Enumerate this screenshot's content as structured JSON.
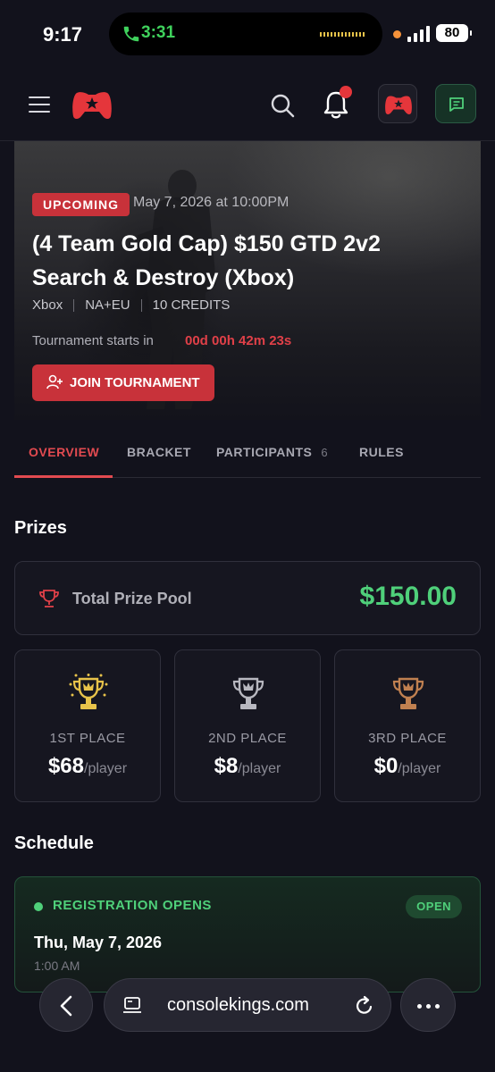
{
  "status_bar": {
    "time": "9:17",
    "call_timer": "3:31",
    "battery": "80"
  },
  "header": {
    "icons": [
      "menu-icon",
      "logo-icon",
      "search-icon",
      "bell-icon",
      "avatar-icon",
      "chat-icon"
    ],
    "notification_dot_color": "#e5363b"
  },
  "hero": {
    "badge": "UPCOMING",
    "date": "May 7, 2026 at 10:00PM",
    "title": "(4 Team Gold Cap) $150 GTD 2v2 Search & Destroy (Xbox)",
    "platform": "Xbox",
    "region": "NA+EU",
    "credits": "10 CREDITS",
    "starts_label": "Tournament starts in",
    "countdown": "00d 00h 42m 23s",
    "join_label": "JOIN TOURNAMENT"
  },
  "tabs": [
    {
      "label": "OVERVIEW",
      "active": true
    },
    {
      "label": "BRACKET",
      "active": false
    },
    {
      "label": "PARTICIPANTS",
      "count": "6",
      "active": false
    },
    {
      "label": "RULES",
      "active": false
    }
  ],
  "prizes": {
    "title": "Prizes",
    "pool_label": "Total Prize Pool",
    "pool_amount": "$150.00",
    "places": [
      {
        "label": "1ST PLACE",
        "amount": "$68",
        "unit": "/player",
        "color": "#e8c34a"
      },
      {
        "label": "2ND PLACE",
        "amount": "$8",
        "unit": "/player",
        "color": "#b8b8c0"
      },
      {
        "label": "3RD PLACE",
        "amount": "$0",
        "unit": "/player",
        "color": "#c08050"
      }
    ]
  },
  "schedule": {
    "title": "Schedule",
    "item_label": "REGISTRATION OPENS",
    "status": "OPEN",
    "date": "Thu, May 7, 2026",
    "time": "1:00 AM"
  },
  "browser": {
    "url": "consolekings.com"
  },
  "colors": {
    "accent_red": "#c8323a",
    "success_green": "#4fd07a",
    "background": "#12121c"
  }
}
